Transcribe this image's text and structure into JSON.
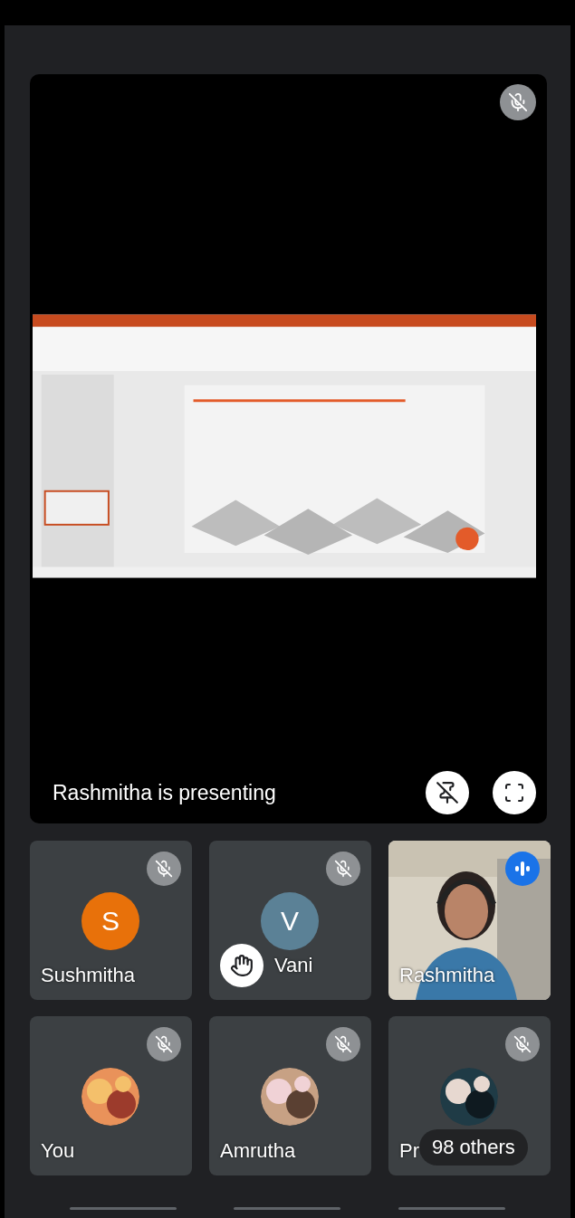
{
  "main_tile": {
    "muted": true,
    "presenter_caption": "Rashmitha is presenting"
  },
  "participants": [
    {
      "name": "Sushmitha",
      "kind": "initial",
      "initial": "S",
      "color": "#e8710a",
      "muted": true,
      "hand_raised": false,
      "speaking": false
    },
    {
      "name": "Vani",
      "kind": "initial",
      "initial": "V",
      "color": "#5b8196",
      "muted": true,
      "hand_raised": true,
      "speaking": false
    },
    {
      "name": "Rashmitha",
      "kind": "video",
      "muted": false,
      "hand_raised": false,
      "speaking": true
    },
    {
      "name": "You",
      "muted": true,
      "hand_raised": false,
      "speaking": false
    },
    {
      "name": "Amrutha",
      "muted": true,
      "hand_raised": false,
      "speaking": false
    },
    {
      "name": "Pr",
      "muted": true,
      "hand_raised": false,
      "speaking": false,
      "others": "98 others"
    }
  ]
}
